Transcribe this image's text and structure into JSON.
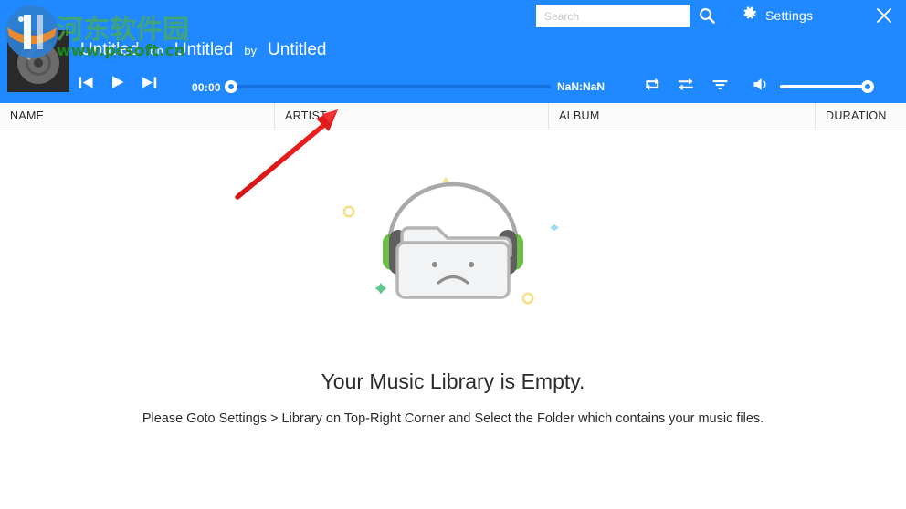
{
  "window": {
    "accent_color": "#2089ff",
    "background_color": "#ffffff"
  },
  "header": {
    "search": {
      "placeholder": "Search",
      "value": ""
    },
    "search_icon": "search-icon",
    "settings_label": "Settings",
    "settings_icon": "gear-icon",
    "close_icon": "close-icon",
    "now_playing": {
      "track": "Untitled",
      "on": "on",
      "album": "Untitled",
      "by": "by",
      "artist": "Untitled"
    },
    "transport": {
      "previous_icon": "previous-track-icon",
      "play_icon": "play-icon",
      "next_icon": "next-track-icon",
      "elapsed_time": "00:00",
      "total_time": "NaN:NaN",
      "seek_position_percent": 0,
      "repeat_icon": "repeat-icon",
      "shuffle_icon": "shuffle-icon",
      "filter_icon": "filter-icon",
      "volume_icon": "volume-icon",
      "volume_percent": 100
    }
  },
  "watermark": {
    "site_name": "河东软件园",
    "site_url": "www.pcsoft.cn"
  },
  "table": {
    "columns": [
      {
        "label": "NAME"
      },
      {
        "label": "ARTIST"
      },
      {
        "label": "ALBUM"
      },
      {
        "label": "DURATION"
      }
    ],
    "rows": []
  },
  "empty_state": {
    "title": "Your Music Library is Empty.",
    "subtitle": "Please Goto Settings > Library on Top-Right Corner and Select the Folder which contains your music files.",
    "illustration": "empty-folder-with-headphones-sad-face",
    "illustration_colors": {
      "folder_outline": "#aaaaaa",
      "folder_fill": "#f2f3f4",
      "earcup_green": "#6cbf45",
      "earpad_gray": "#5f5f5f",
      "dot_yellow": "#f0e08a",
      "dot_green": "#55c68a",
      "dot_teal": "#8fdbe8"
    }
  },
  "annotation": {
    "arrow_color": "#e01b1b",
    "points_to": "ARTIST"
  }
}
